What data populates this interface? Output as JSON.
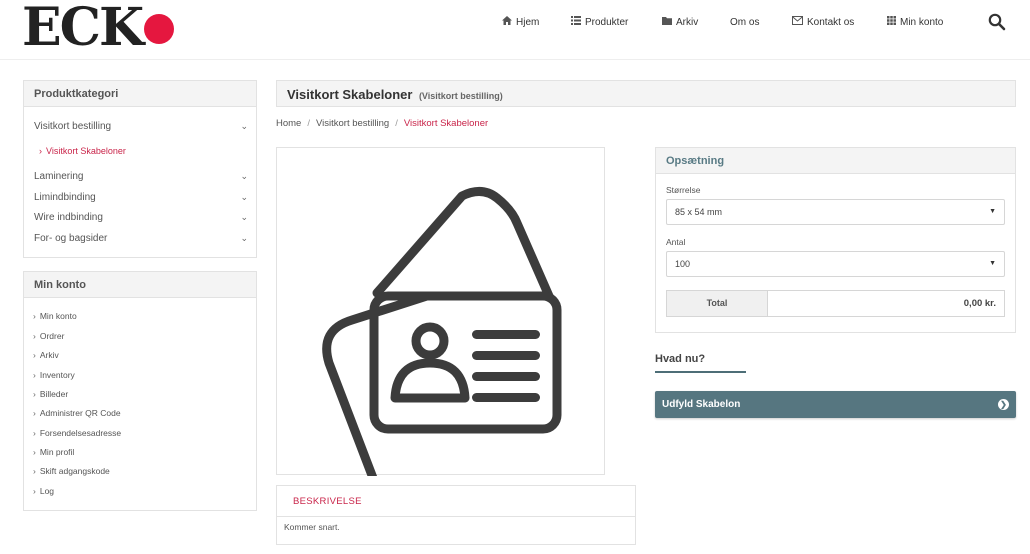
{
  "brand": {
    "logo_text": "ECK",
    "accent": "#e5173f"
  },
  "nav": {
    "items": [
      {
        "label": "Hjem",
        "icon": "home-icon"
      },
      {
        "label": "Produkter",
        "icon": "list-icon"
      },
      {
        "label": "Arkiv",
        "icon": "folder-icon"
      },
      {
        "label": "Om os",
        "icon": ""
      },
      {
        "label": "Kontakt os",
        "icon": "envelope-icon"
      },
      {
        "label": "Min konto",
        "icon": "grid-icon"
      }
    ],
    "search_icon": "search-icon"
  },
  "sidebar": {
    "categories": {
      "title": "Produktkategori",
      "items": [
        {
          "label": "Visitkort bestilling",
          "expanded": true
        },
        {
          "label": "Laminering"
        },
        {
          "label": "Limindbinding"
        },
        {
          "label": "Wire indbinding"
        },
        {
          "label": "For- og bagsider"
        }
      ],
      "sub_item": "Visitkort Skabeloner"
    },
    "account": {
      "title": "Min konto",
      "items": [
        "Min konto",
        "Ordrer",
        "Arkiv",
        "Inventory",
        "Billeder",
        "Administrer QR Code",
        "Forsendelsesadresse",
        "Min profil",
        "Skift adgangskode",
        "Log"
      ]
    }
  },
  "main": {
    "title": "Visitkort Skabeloner",
    "subtitle": "(Visitkort bestilling)",
    "breadcrumb": [
      "Home",
      "Visitkort bestilling",
      "Visitkort Skabeloner"
    ],
    "description_tab": "BESKRIVELSE",
    "description_text": "Kommer snart."
  },
  "options": {
    "title": "Opsætning",
    "size_label": "Størrelse",
    "size_value": "85 x 54 mm",
    "qty_label": "Antal",
    "qty_value": "100",
    "total_label": "Total",
    "total_value": "0,00 kr."
  },
  "cta": {
    "heading": "Hvad nu?",
    "button_label": "Udfyld Skabelon",
    "button_color": "#567680"
  },
  "colors": {
    "link_active": "#c9254a",
    "panel_header": "#f4f4f4"
  }
}
